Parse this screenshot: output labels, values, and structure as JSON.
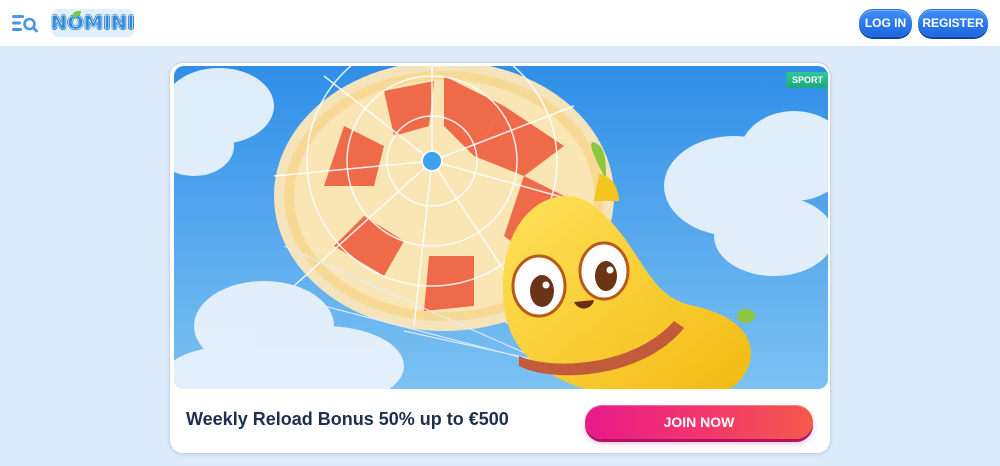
{
  "header": {
    "logo_text": "NOMINI",
    "login_label": "LOG IN",
    "register_label": "REGISTER",
    "menu_icon": "menu-search-icon"
  },
  "promo": {
    "category": "SPORT",
    "title": "Weekly Reload Bonus 50% up to €500",
    "cta_label": "JOIN NOW",
    "image_subject": "banana-parachute-illustration"
  },
  "colors": {
    "page_bg": "#dceaf9",
    "primary_blue": "#2a74e6",
    "cta_pink": "#ea2580",
    "sport_green": "#25b98c",
    "title_text": "#1e2f4d"
  }
}
